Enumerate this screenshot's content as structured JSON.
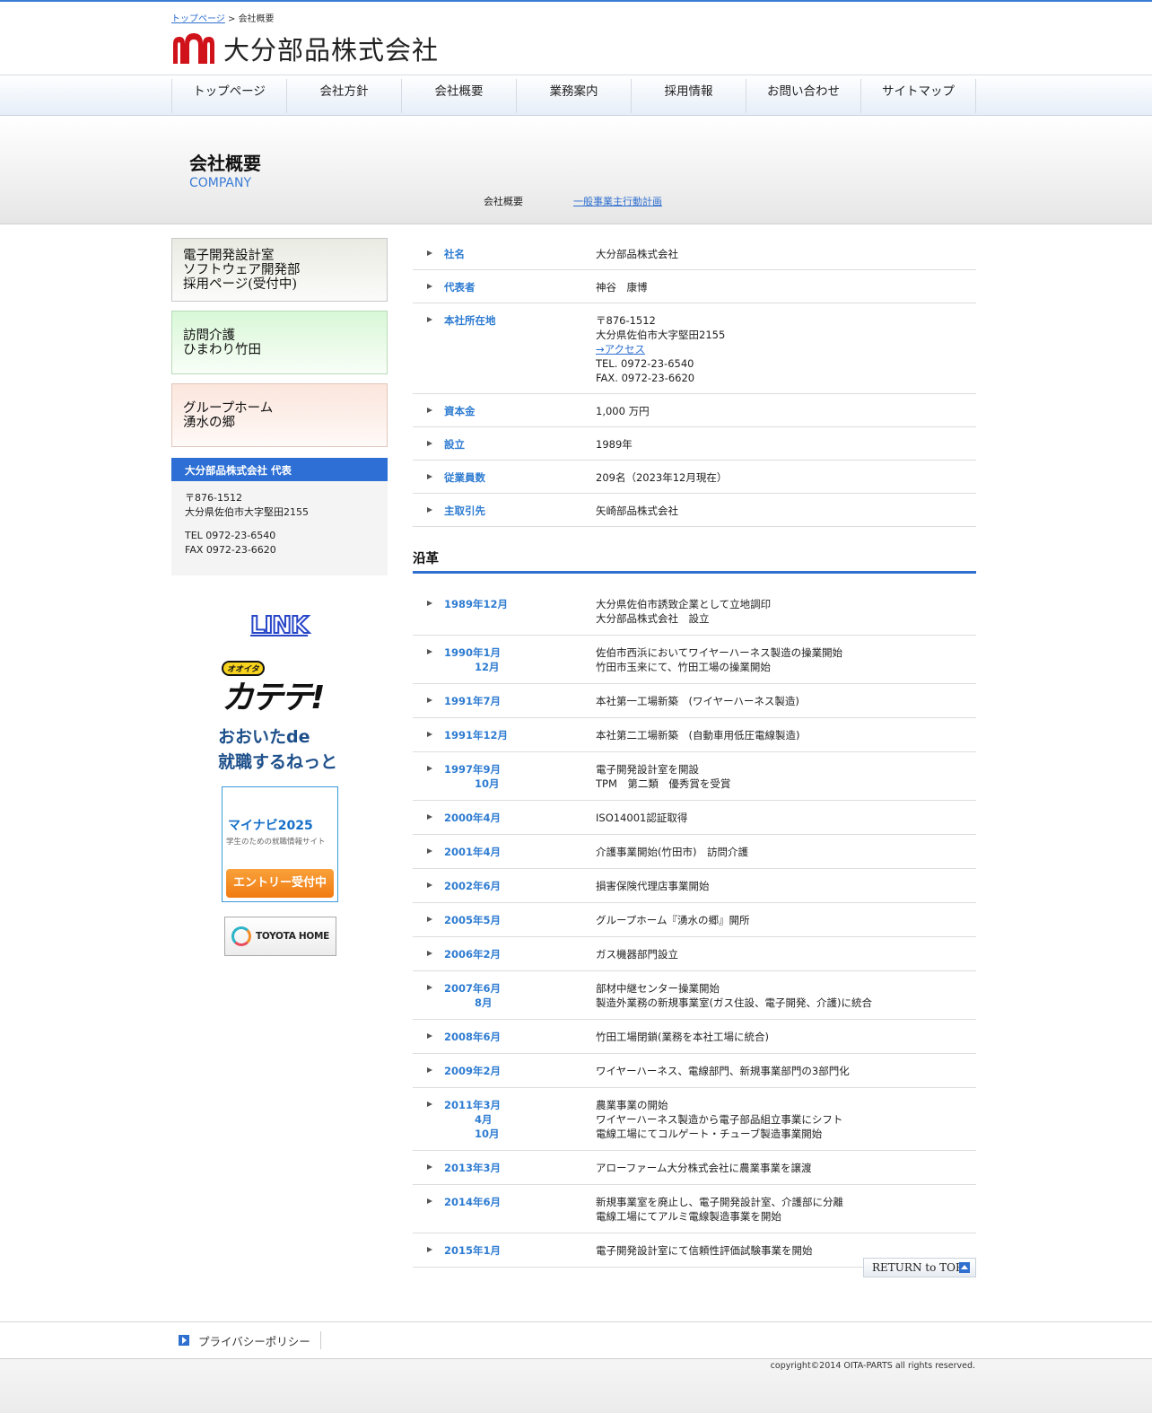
{
  "breadcrumb": {
    "home": "トップページ",
    "separator": " > ",
    "current": "会社概要"
  },
  "brand": {
    "name": "大分部品株式会社",
    "logo_color": "#d0121b"
  },
  "nav": {
    "items": [
      "トップページ",
      "会社方針",
      "会社概要",
      "業務案内",
      "採用情報",
      "お問い合わせ",
      "サイトマップ"
    ]
  },
  "hero": {
    "title": "会社概要",
    "subtitle": "COMPANY",
    "current_link": "会社概要",
    "other_link": "一般事業主行動計画"
  },
  "sidebar": {
    "banners": [
      {
        "lines": [
          "電子開発設計室",
          "ソフトウェア開発部",
          "採用ページ(受付中)"
        ]
      },
      {
        "lines": [
          "訪問介護",
          "ひまわり竹田"
        ]
      },
      {
        "lines": [
          "グループホーム",
          "湧水の郷"
        ]
      }
    ],
    "rep": {
      "title": "大分部品株式会社 代表",
      "postal": "〒876-1512",
      "address": "大分県佐伯市大字堅田2155",
      "tel": "TEL 0972-23-6540",
      "fax": "FAX 0972-23-6620"
    },
    "link_logo": "LINK",
    "katete": {
      "badge": "オオイタ",
      "text": "カテテ!"
    },
    "oita": {
      "line1": "おおいたde",
      "line2": "就職するねっと"
    },
    "mynavi": {
      "title": "マイナビ2025",
      "tagline": "学生のための就職情報サイト",
      "button": "エントリー受付中"
    },
    "toyota": "TOYOTA HOME"
  },
  "profile": [
    {
      "key": "社名",
      "values": [
        "大分部品株式会社"
      ]
    },
    {
      "key": "代表者",
      "values": [
        "神谷　康博"
      ]
    },
    {
      "key": "本社所在地",
      "values": [
        "〒876-1512",
        "大分県佐伯市大字堅田2155"
      ],
      "link": "→アクセス",
      "extra": [
        "TEL. 0972-23-6540",
        "FAX. 0972-23-6620"
      ]
    },
    {
      "key": "資本金",
      "values": [
        "1,000 万円"
      ]
    },
    {
      "key": "設立",
      "values": [
        "1989年"
      ]
    },
    {
      "key": "従業員数",
      "values": [
        "209名（2023年12月現在）"
      ]
    },
    {
      "key": "主取引先",
      "values": [
        "矢崎部品株式会社"
      ]
    }
  ],
  "history_title": "沿革",
  "history": [
    {
      "dates": [
        "1989年12月"
      ],
      "events": [
        "大分県佐伯市誘致企業として立地調印",
        "大分部品株式会社　設立"
      ]
    },
    {
      "dates": [
        "1990年1月",
        "12月"
      ],
      "events": [
        "佐伯市西浜においてワイヤーハーネス製造の操業開始",
        "竹田市玉来にて、竹田工場の操業開始"
      ]
    },
    {
      "dates": [
        "1991年7月"
      ],
      "events": [
        "本社第一工場新築　(ワイヤーハーネス製造)"
      ]
    },
    {
      "dates": [
        "1991年12月"
      ],
      "events": [
        "本社第二工場新築　(自動車用低圧電線製造)"
      ]
    },
    {
      "dates": [
        "1997年9月",
        "10月"
      ],
      "events": [
        "電子開発設計室を開設",
        "TPM　第二類　優秀賞を受賞"
      ]
    },
    {
      "dates": [
        "2000年4月"
      ],
      "events": [
        "ISO14001認証取得"
      ]
    },
    {
      "dates": [
        "2001年4月"
      ],
      "events": [
        "介護事業開始(竹田市)　訪問介護"
      ]
    },
    {
      "dates": [
        "2002年6月"
      ],
      "events": [
        "損害保険代理店事業開始"
      ]
    },
    {
      "dates": [
        "2005年5月"
      ],
      "events": [
        "グループホーム『湧水の郷』開所"
      ]
    },
    {
      "dates": [
        "2006年2月"
      ],
      "events": [
        "ガス機器部門設立"
      ]
    },
    {
      "dates": [
        "2007年6月",
        "8月"
      ],
      "events": [
        "部材中継センター操業開始",
        "製造外業務の新規事業室(ガス住設、電子開発、介護)に統合"
      ]
    },
    {
      "dates": [
        "2008年6月"
      ],
      "events": [
        "竹田工場閉鎖(業務を本社工場に統合)"
      ]
    },
    {
      "dates": [
        "2009年2月"
      ],
      "events": [
        "ワイヤーハーネス、電線部門、新規事業部門の3部門化"
      ]
    },
    {
      "dates": [
        "2011年3月",
        "4月",
        "10月"
      ],
      "events": [
        "農業事業の開始",
        "ワイヤーハーネス製造から電子部品組立事業にシフト",
        "電線工場にてコルゲート・チューブ製造事業開始"
      ]
    },
    {
      "dates": [
        "2013年3月"
      ],
      "events": [
        "アローファーム大分株式会社に農業事業を譲渡"
      ]
    },
    {
      "dates": [
        "2014年6月"
      ],
      "events": [
        "新規事業室を廃止し、電子開発設計室、介護部に分離",
        "電線工場にてアルミ電線製造事業を開始"
      ]
    },
    {
      "dates": [
        "2015年1月"
      ],
      "events": [
        "電子開発設計室にて信頼性評価試験事業を開始"
      ]
    }
  ],
  "return_top": "RETURN to TOP",
  "footer": {
    "privacy": "プライバシーポリシー",
    "copyright": "copyright©2014 OITA-PARTS all rights reserved."
  }
}
